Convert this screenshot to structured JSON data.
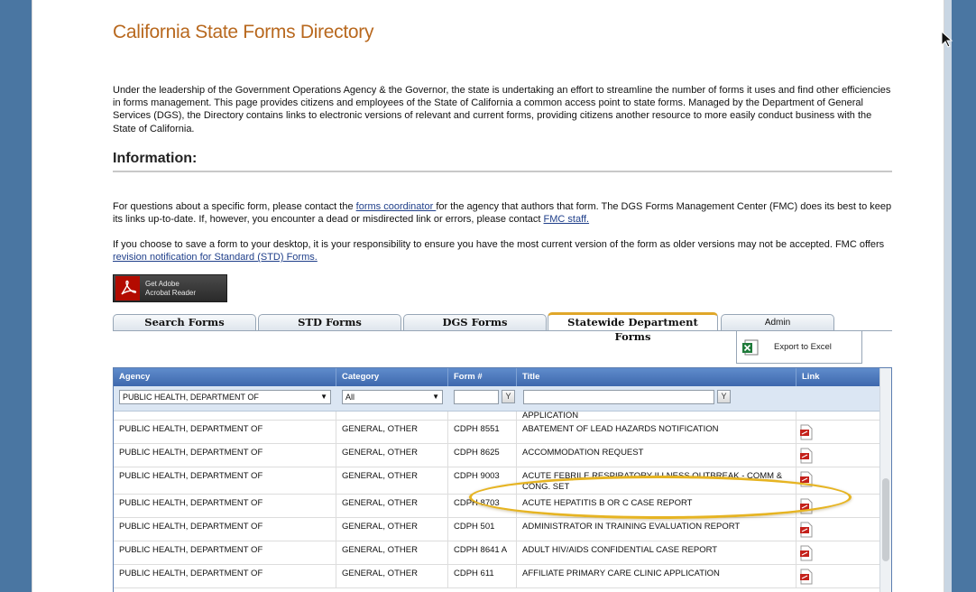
{
  "page": {
    "title": "California State Forms Directory",
    "intro": "Under the leadership of the Government Operations Agency & the Governor, the state is undertaking an effort to streamline the number of forms it uses and find other efficiencies in forms management. This page provides citizens and employees of the State of California a common access point to state forms. Managed by the Department of General Services (DGS), the Directory contains links to electronic versions of relevant and current forms, providing citizens another resource to more easily conduct business with the State of California.",
    "info_heading": "Information:",
    "info_p1_a": "For questions about a specific form, please contact the ",
    "info_p1_link": "forms coordinator ",
    "info_p1_b": "for the agency that authors that form. The DGS Forms Management Center (FMC) does its best to keep its links up-to-date. If, however, you encounter a dead or misdirected link or errors, please contact ",
    "info_p1_link2": "FMC staff.",
    "info_p2_a": "If you choose to save a form to your desktop, it is your responsibility to ensure you have the most current version of the form as older versions may not be accepted. FMC offers ",
    "info_p2_link": "revision notification for Standard (STD) Forms."
  },
  "adobe": {
    "line1": "Get Adobe",
    "line2": "Acrobat Reader"
  },
  "tabs": [
    {
      "label": "Search Forms"
    },
    {
      "label": "STD Forms"
    },
    {
      "label": "DGS Forms"
    },
    {
      "label": "Statewide Department Forms"
    },
    {
      "label": "Admin"
    }
  ],
  "export_label": "Export to Excel",
  "grid": {
    "columns": [
      "Agency",
      "Category",
      "Form #",
      "Title",
      "Link"
    ],
    "filters": {
      "agency": "PUBLIC HEALTH, DEPARTMENT OF",
      "category": "All",
      "form_no": "",
      "title": ""
    },
    "partial_row_title": "APPLICATION",
    "rows": [
      {
        "agency": "PUBLIC HEALTH, DEPARTMENT OF",
        "category": "GENERAL, OTHER",
        "form": "CDPH 8551",
        "title": "ABATEMENT OF LEAD HAZARDS NOTIFICATION"
      },
      {
        "agency": "PUBLIC HEALTH, DEPARTMENT OF",
        "category": "GENERAL, OTHER",
        "form": "CDPH 8625",
        "title": "ACCOMMODATION REQUEST"
      },
      {
        "agency": "PUBLIC HEALTH, DEPARTMENT OF",
        "category": "GENERAL, OTHER",
        "form": "CDPH 9003",
        "title": "ACUTE FEBRILE RESPIRATORY ILLNESS OUTBREAK - COMM &",
        "title2": "CONG. SET"
      },
      {
        "agency": "PUBLIC HEALTH, DEPARTMENT OF",
        "category": "GENERAL, OTHER",
        "form": "CDPH 8703",
        "title": "ACUTE HEPATITIS B OR C CASE REPORT"
      },
      {
        "agency": "PUBLIC HEALTH, DEPARTMENT OF",
        "category": "GENERAL, OTHER",
        "form": "CDPH 501",
        "title": "ADMINISTRATOR IN TRAINING EVALUATION REPORT"
      },
      {
        "agency": "PUBLIC HEALTH, DEPARTMENT OF",
        "category": "GENERAL, OTHER",
        "form": "CDPH 8641 A",
        "title": "ADULT HIV/AIDS CONFIDENTIAL CASE REPORT"
      },
      {
        "agency": "PUBLIC HEALTH, DEPARTMENT OF",
        "category": "GENERAL, OTHER",
        "form": "CDPH 611",
        "title": "AFFILIATE PRIMARY CARE CLINIC APPLICATION"
      }
    ]
  },
  "colors": {
    "title": "#b8681e",
    "header": "#4a76b8",
    "highlight": "#e6b422",
    "pdf": "#c4211b"
  },
  "icons": {
    "pdf": "pdf-file-icon",
    "excel": "excel-icon",
    "filter": "filter-icon",
    "adobe": "adobe-reader-icon"
  }
}
